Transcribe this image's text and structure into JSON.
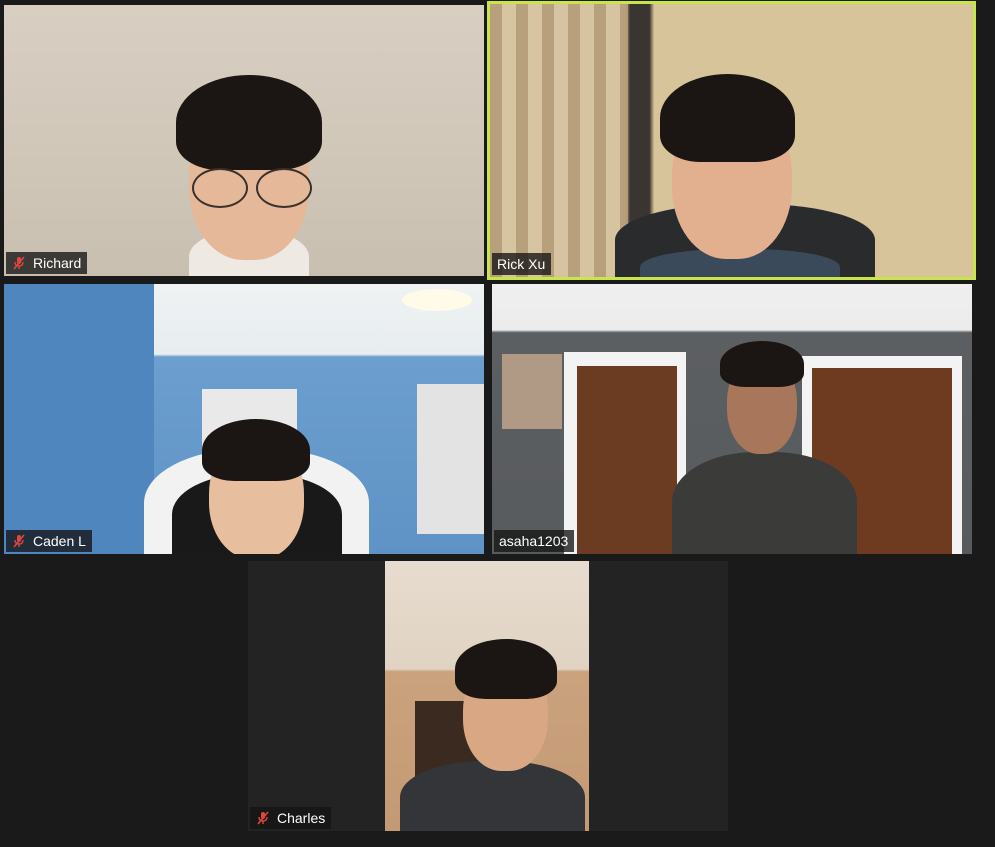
{
  "participants": [
    {
      "name": "Richard",
      "muted": true,
      "active": false
    },
    {
      "name": "Rick Xu",
      "muted": false,
      "active": true
    },
    {
      "name": "Caden L",
      "muted": true,
      "active": false
    },
    {
      "name": "asaha1203",
      "muted": false,
      "active": false
    },
    {
      "name": "Charles",
      "muted": true,
      "active": false
    }
  ],
  "colors": {
    "background": "#1a1a1a",
    "active_speaker_border": "#c8e64c",
    "mute_icon": "#e0463b"
  },
  "icons": {
    "muted": "microphone-muted-icon"
  }
}
